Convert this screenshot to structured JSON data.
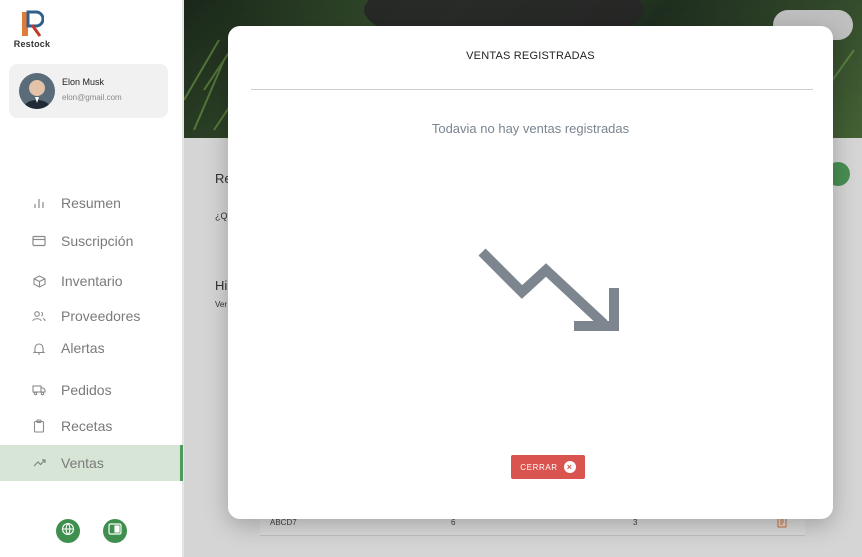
{
  "app": {
    "name": "Restock"
  },
  "profile": {
    "name": "Elon Musk",
    "email": "elon@gmail.com"
  },
  "sidebar": {
    "items": [
      {
        "label": "Resumen",
        "icon": "bar-chart-icon"
      },
      {
        "label": "Suscripción",
        "icon": "credit-card-icon"
      },
      {
        "label": "Inventario",
        "icon": "box-icon"
      },
      {
        "label": "Proveedores",
        "icon": "users-icon"
      },
      {
        "label": "Alertas",
        "icon": "bell-icon"
      },
      {
        "label": "Pedidos",
        "icon": "truck-icon"
      },
      {
        "label": "Recetas",
        "icon": "clipboard-icon"
      },
      {
        "label": "Ventas",
        "icon": "trending-up-icon",
        "active": true
      }
    ]
  },
  "background": {
    "heading_fragment": "Re",
    "question_fragment": "¿Q",
    "section_fragment": "Hi",
    "sub_fragment": "Ver",
    "row": {
      "code": "ABCD7",
      "qty": "6",
      "count": "3"
    }
  },
  "modal": {
    "title": "VENTAS REGISTRADAS",
    "empty_message": "Todavia no hay ventas registradas",
    "close_label": "CERRAR"
  },
  "colors": {
    "accent": "#4e9a5a",
    "active_bg": "#d6e5d6",
    "danger": "#d9534f"
  }
}
